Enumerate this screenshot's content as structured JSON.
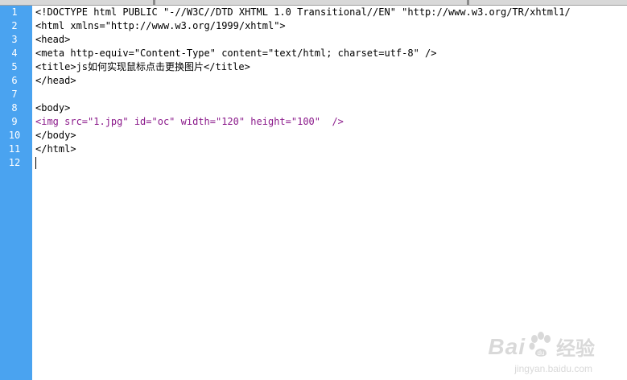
{
  "editor": {
    "line_numbers": [
      "1",
      "2",
      "3",
      "4",
      "5",
      "6",
      "7",
      "8",
      "9",
      "10",
      "11",
      "12"
    ],
    "lines": [
      "<!DOCTYPE html PUBLIC \"-//W3C//DTD XHTML 1.0 Transitional//EN\" \"http://www.w3.org/TR/xhtml1/",
      "<html xmlns=\"http://www.w3.org/1999/xhtml\">",
      "<head>",
      "<meta http-equiv=\"Content-Type\" content=\"text/html; charset=utf-8\" />",
      "<title>js如何实现鼠标点击更换图片</title>",
      "</head>",
      "",
      "<body>",
      "<img src=\"1.jpg\" id=\"oc\" width=\"120\" height=\"100\"  />",
      "</body>",
      "</html>",
      ""
    ]
  },
  "watermark": {
    "brand_left": "Bai",
    "brand_right": "经验",
    "url": "jingyan.baidu.com"
  },
  "colors": {
    "gutter": "#4aa3f0",
    "tag_purple": "#8b1a8b",
    "watermark": "#d9d9d9"
  }
}
